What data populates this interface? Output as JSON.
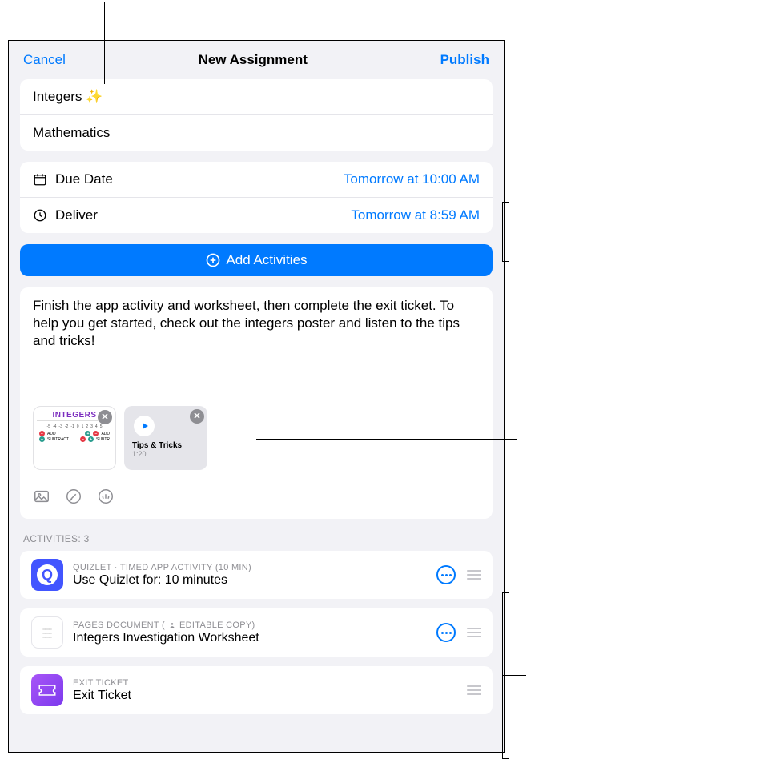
{
  "header": {
    "cancel": "Cancel",
    "title": "New Assignment",
    "publish": "Publish"
  },
  "assignment": {
    "name": "Integers ✨",
    "class": "Mathematics"
  },
  "dueDate": {
    "label": "Due Date",
    "value": "Tomorrow at 10:00 AM"
  },
  "deliver": {
    "label": "Deliver",
    "value": "Tomorrow at 8:59 AM"
  },
  "addActivities": "Add Activities",
  "description": "Finish the app activity and worksheet, then complete the exit ticket. To help you get started, check out the integers poster and listen to the tips and tricks!",
  "attachments": {
    "poster": {
      "title": "INTEGERS"
    },
    "audio": {
      "name": "Tips & Tricks",
      "duration": "1:20"
    }
  },
  "activitiesHeader": "ACTIVITIES: 3",
  "activities": [
    {
      "meta": "QUIZLET · TIMED APP ACTIVITY (10 MIN)",
      "editableBadge": "",
      "title": "Use Quizlet for: 10 minutes",
      "hasMore": true
    },
    {
      "meta": "PAGES DOCUMENT  (",
      "editableBadge": " EDITABLE COPY)",
      "title": "Integers Investigation Worksheet",
      "hasMore": true
    },
    {
      "meta": "EXIT TICKET",
      "editableBadge": "",
      "title": "Exit Ticket",
      "hasMore": false
    }
  ]
}
